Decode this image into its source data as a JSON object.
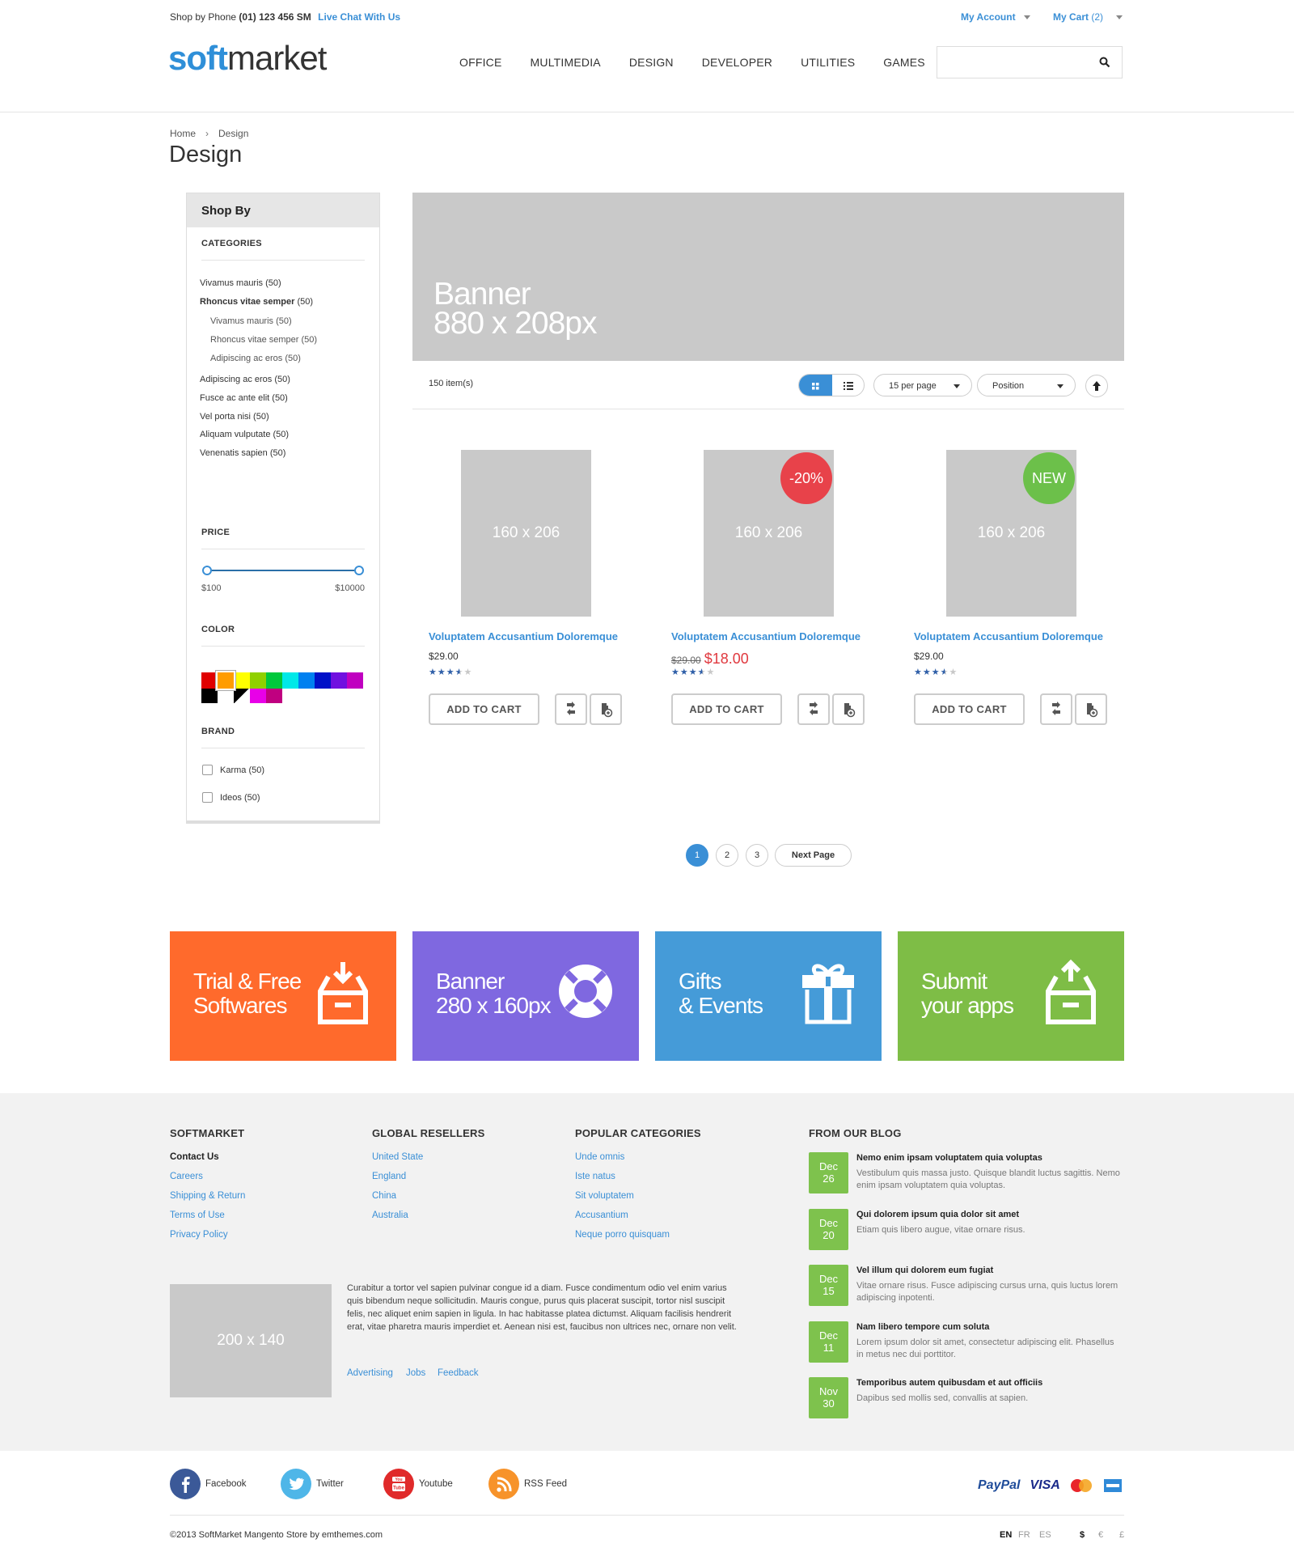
{
  "topbar": {
    "phone_label": "Shop by Phone",
    "phone_number": "(01) 123 456 SM",
    "live_chat": "Live Chat With Us",
    "my_account": "My Account",
    "my_cart": "My Cart",
    "cart_count": "(2)"
  },
  "header": {
    "logo_soft": "soft",
    "logo_market": "market",
    "nav": [
      "OFFICE",
      "MULTIMEDIA",
      "DESIGN",
      "DEVELOPER",
      "UTILITIES",
      "GAMES"
    ],
    "search_placeholder": ""
  },
  "breadcrumb": {
    "home": "Home",
    "sep": "›",
    "current": "Design"
  },
  "page_title": "Design",
  "sidebar": {
    "title": "Shop By",
    "categories_title": "CATEGORIES",
    "categories": [
      {
        "label": "Vivamus mauris",
        "count": "(50)",
        "bold": false,
        "sub": false
      },
      {
        "label": "Rhoncus vitae semper",
        "count": "(50)",
        "bold": true,
        "sub": false
      },
      {
        "label": "Vivamus mauris",
        "count": "(50)",
        "bold": false,
        "sub": true
      },
      {
        "label": "Rhoncus vitae semper",
        "count": "(50)",
        "bold": false,
        "sub": true
      },
      {
        "label": "Adipiscing ac eros",
        "count": "(50)",
        "bold": false,
        "sub": true
      },
      {
        "label": "Adipiscing ac eros",
        "count": "(50)",
        "bold": false,
        "sub": false
      },
      {
        "label": "Fusce ac ante elit",
        "count": "(50)",
        "bold": false,
        "sub": false
      },
      {
        "label": "Vel porta nisi",
        "count": "(50)",
        "bold": false,
        "sub": false
      },
      {
        "label": "Aliquam vulputate",
        "count": "(50)",
        "bold": false,
        "sub": false
      },
      {
        "label": "Venenatis sapien",
        "count": "(50)",
        "bold": false,
        "sub": false
      }
    ],
    "price_title": "PRICE",
    "price_min": "$100",
    "price_max": "$10000",
    "color_title": "COLOR",
    "colors_row1": [
      "#e00000",
      "#ff9c00",
      "#ffff00",
      "#90d000",
      "#00c83c",
      "#00e8e8",
      "#0080f0",
      "#0010c8",
      "#7010e0",
      "#c000c0"
    ],
    "colors_row2": [
      "#000000",
      "#ffffff",
      "#000000",
      "#e800e8",
      "#c00080"
    ],
    "selected_color": "#ff9c00",
    "brand_title": "BRAND",
    "brands": [
      {
        "label": "Karma",
        "count": "(50)"
      },
      {
        "label": "Ideos",
        "count": "(50)"
      }
    ]
  },
  "banner": {
    "text": "Banner\n880 x 208px"
  },
  "toolbar": {
    "items_count": "150 item(s)",
    "per_page": "15 per page",
    "sort_by": "Position",
    "view_mode": "grid"
  },
  "products": [
    {
      "image_label": "160 x 206",
      "name": "Voluptatem Accusantium Doloremque",
      "price": "$29.00",
      "old_price": "",
      "rating": 3.5,
      "badge": "",
      "badge_color": "",
      "button": "ADD TO CART"
    },
    {
      "image_label": "160 x 206",
      "name": "Voluptatem Accusantium Doloremque",
      "price": "$18.00",
      "old_price": "$29.00",
      "rating": 3.5,
      "badge": "-20%",
      "badge_color": "#e8424a",
      "button": "ADD TO CART"
    },
    {
      "image_label": "160 x 206",
      "name": "Voluptatem Accusantium Doloremque",
      "price": "$29.00",
      "old_price": "",
      "rating": 3.5,
      "badge": "NEW",
      "badge_color": "#6cc04a",
      "button": "ADD TO CART"
    }
  ],
  "pagination": {
    "pages": [
      "1",
      "2",
      "3"
    ],
    "current": "1",
    "next": "Next Page"
  },
  "promos": [
    {
      "text": "Trial & Free\nSoftwares",
      "color": "#ff6a2c",
      "icon": "inbox-download-icon"
    },
    {
      "text": "Banner\n280 x 160px",
      "color": "#7f68e0",
      "icon": "lifebuoy-icon"
    },
    {
      "text": "Gifts\n& Events",
      "color": "#459bd8",
      "icon": "gift-icon"
    },
    {
      "text": "Submit\nyour apps",
      "color": "#7ebd46",
      "icon": "inbox-upload-icon"
    }
  ],
  "footer": {
    "softmarket_title": "SOFTMARKET",
    "softmarket_links": [
      "Contact Us",
      "Careers",
      "Shipping & Return",
      "Terms of Use",
      "Privacy Policy"
    ],
    "resellers_title": "GLOBAL RESELLERS",
    "resellers_links": [
      "United State",
      "England",
      "China",
      "Australia"
    ],
    "categories_title": "POPULAR CATEGORIES",
    "categories_links": [
      "Unde omnis",
      "Iste natus",
      "Sit voluptatem",
      "Accusantium",
      "Neque porro quisquam"
    ],
    "image_label": "200 x 140",
    "paragraph": "Curabitur a tortor vel sapien pulvinar congue id a diam. Fusce condimentum odio vel enim varius quis bibendum neque sollicitudin. Mauris congue, purus quis placerat suscipit, tortor nisl suscipit felis, nec aliquet enim sapien in ligula. In hac habitasse platea dictumst. Aliquam facilisis hendrerit erat, vitae pharetra mauris imperdiet et. Aenean nisi est, faucibus non ultrices nec, ornare non velit.",
    "small_links": [
      "Advertising",
      "Jobs",
      "Feedback"
    ],
    "blog_title": "FROM OUR BLOG",
    "blog": [
      {
        "month": "Dec",
        "day": "26",
        "title": "Nemo enim ipsam voluptatem quia voluptas",
        "summary": "Vestibulum quis massa justo. Quisque blandit luctus sagittis. Nemo enim ipsam voluptatem quia voluptas."
      },
      {
        "month": "Dec",
        "day": "20",
        "title": "Qui dolorem ipsum quia dolor sit amet",
        "summary": "Etiam quis libero augue, vitae ornare risus."
      },
      {
        "month": "Dec",
        "day": "15",
        "title": "Vel illum qui dolorem eum fugiat",
        "summary": "Vitae ornare risus. Fusce adipiscing cursus urna, quis luctus lorem adipiscing inpotenti."
      },
      {
        "month": "Dec",
        "day": "11",
        "title": "Nam libero tempore cum soluta",
        "summary": "Lorem ipsum dolor sit amet, consectetur adipiscing elit. Phasellus in metus nec dui porttitor."
      },
      {
        "month": "Nov",
        "day": "30",
        "title": "Temporibus autem quibusdam et aut officiis",
        "summary": "Dapibus sed mollis sed, convallis at sapien."
      }
    ]
  },
  "bottom": {
    "social": [
      {
        "label": "Facebook",
        "color": "#3b5998",
        "icon": "facebook-icon"
      },
      {
        "label": "Twitter",
        "color": "#4fb6e8",
        "icon": "twitter-icon"
      },
      {
        "label": "Youtube",
        "color": "#e02a2a",
        "icon": "youtube-icon"
      },
      {
        "label": "RSS Feed",
        "color": "#f7932a",
        "icon": "rss-icon"
      }
    ],
    "payments": [
      "PayPal",
      "VISA"
    ],
    "copyright": "©2013 SoftMarket Mangento Store by emthemes.com",
    "languages": [
      "EN",
      "FR",
      "ES"
    ],
    "currencies": [
      "$",
      "€",
      "£"
    ]
  }
}
